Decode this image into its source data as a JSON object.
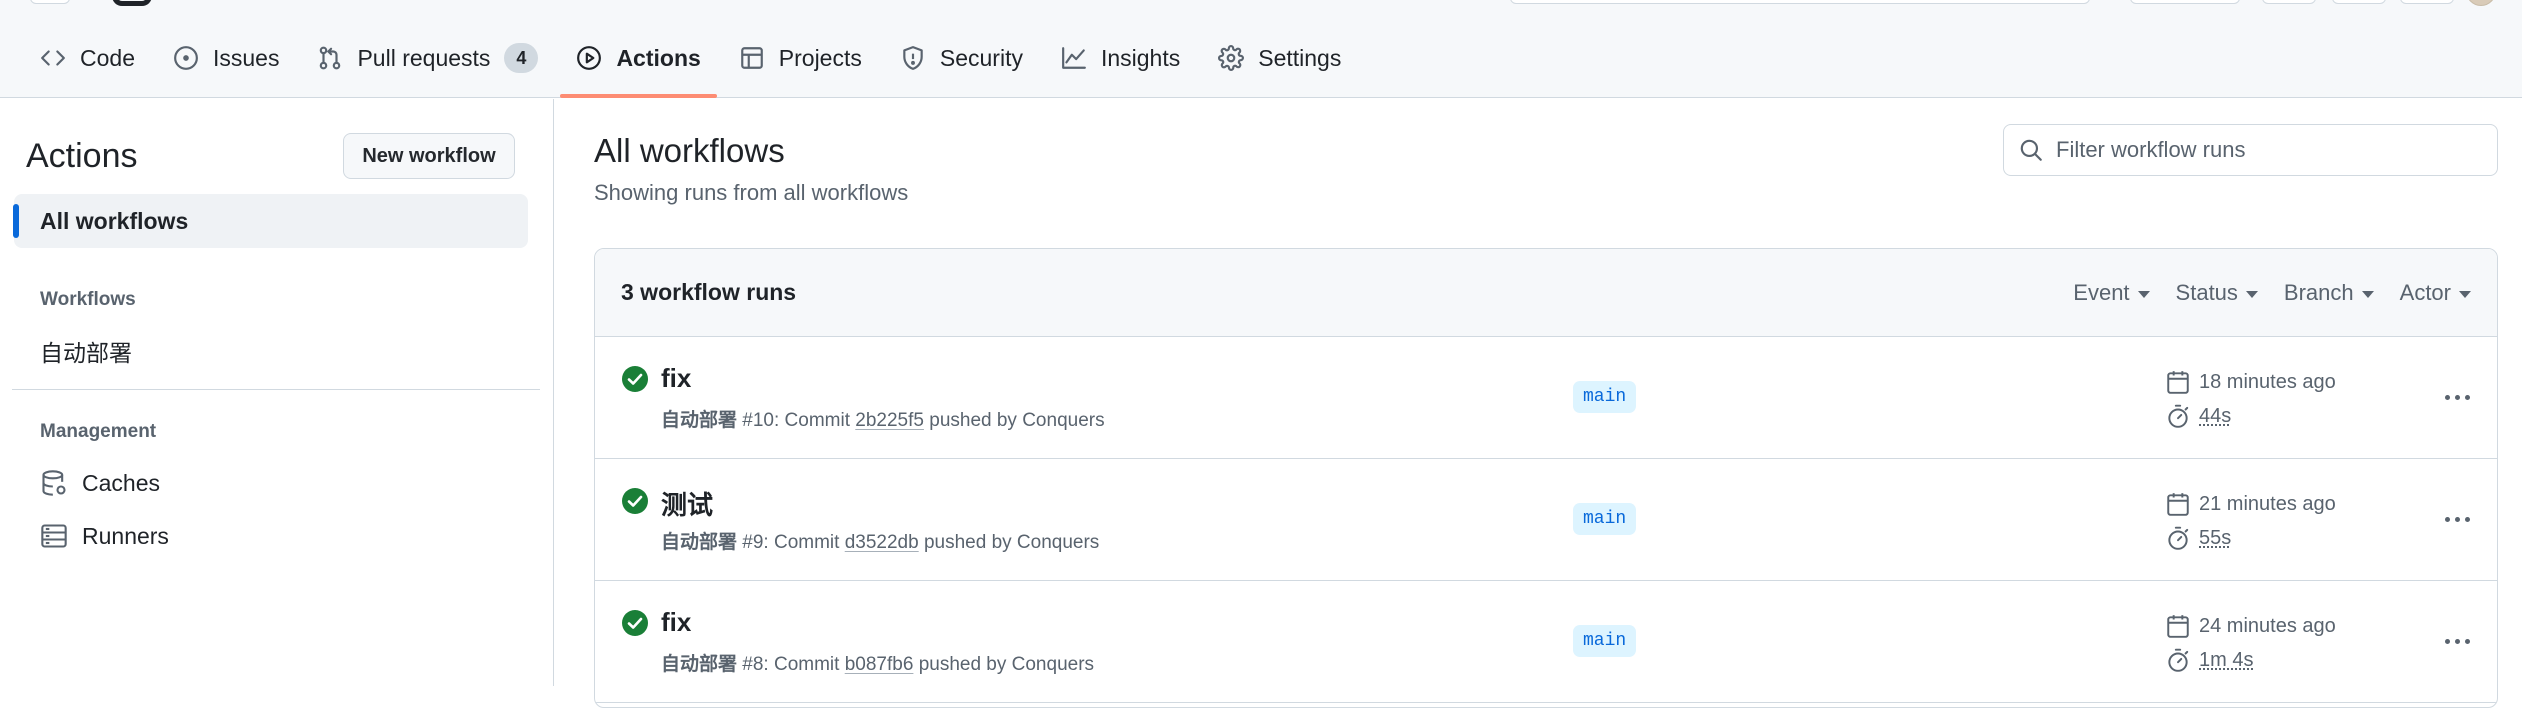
{
  "nav": {
    "items": [
      {
        "label": "Code",
        "icon": "code-icon"
      },
      {
        "label": "Issues",
        "icon": "issue-opened-icon"
      },
      {
        "label": "Pull requests",
        "icon": "git-pull-request-icon",
        "count": "4"
      },
      {
        "label": "Actions",
        "icon": "play-icon",
        "active": true
      },
      {
        "label": "Projects",
        "icon": "table-icon"
      },
      {
        "label": "Security",
        "icon": "shield-icon"
      },
      {
        "label": "Insights",
        "icon": "graph-icon"
      },
      {
        "label": "Settings",
        "icon": "gear-icon"
      }
    ]
  },
  "sidebar": {
    "title": "Actions",
    "new_workflow": "New workflow",
    "all_workflows": "All workflows",
    "workflows_heading": "Workflows",
    "workflows": [
      "自动部署"
    ],
    "management_heading": "Management",
    "management": [
      {
        "label": "Caches",
        "icon": "database-icon"
      },
      {
        "label": "Runners",
        "icon": "server-icon"
      }
    ]
  },
  "main": {
    "title": "All workflows",
    "subtitle": "Showing runs from all workflows",
    "filter_placeholder": "Filter workflow runs",
    "run_count": "3 workflow runs",
    "filters": [
      "Event",
      "Status",
      "Branch",
      "Actor"
    ],
    "runs": [
      {
        "title": "fix",
        "workflow": "自动部署",
        "number_text": "#10: Commit",
        "sha": "2b225f5",
        "pushed_by": "pushed by Conquers",
        "branch": "main",
        "time": "18 minutes ago",
        "duration": "44s",
        "status": "success"
      },
      {
        "title": "测试",
        "workflow": "自动部署",
        "number_text": "#9: Commit",
        "sha": "d3522db",
        "pushed_by": "pushed by Conquers",
        "branch": "main",
        "time": "21 minutes ago",
        "duration": "55s",
        "status": "success"
      },
      {
        "title": "fix",
        "workflow": "自动部署",
        "number_text": "#8: Commit",
        "sha": "b087fb6",
        "pushed_by": "pushed by Conquers",
        "branch": "main",
        "time": "24 minutes ago",
        "duration": "1m 4s",
        "status": "success"
      }
    ]
  },
  "colors": {
    "accent": "#0969da",
    "success": "#1a7f37",
    "active_underline": "#fd8c73",
    "branch_bg": "#ddf4ff"
  }
}
